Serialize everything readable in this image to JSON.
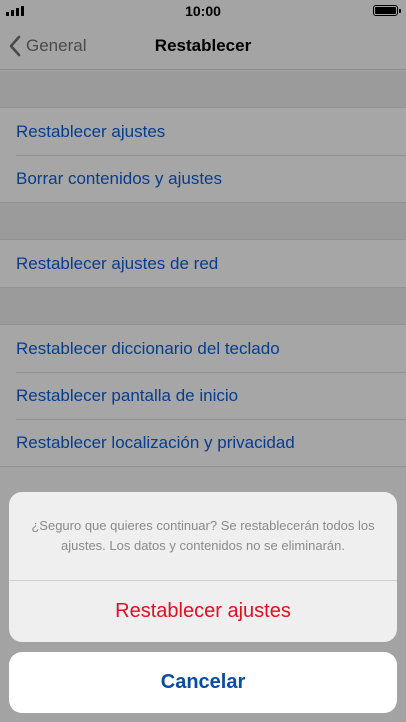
{
  "status": {
    "time": "10:00"
  },
  "nav": {
    "back_label": "General",
    "title": "Restablecer"
  },
  "groups": [
    {
      "items": [
        "Restablecer ajustes",
        "Borrar contenidos y ajustes"
      ]
    },
    {
      "items": [
        "Restablecer ajustes de red"
      ]
    },
    {
      "items": [
        "Restablecer diccionario del teclado",
        "Restablecer pantalla de inicio",
        "Restablecer localización y privacidad"
      ]
    }
  ],
  "sheet": {
    "message": "¿Seguro que quieres continuar? Se restablecerán todos los ajustes. Los datos y contenidos no se eliminarán.",
    "destructive_label": "Restablecer ajustes",
    "cancel_label": "Cancelar"
  },
  "icons": {
    "back": "chevron-left-icon",
    "signal": "cellular-signal-icon",
    "battery": "battery-full-icon"
  },
  "colors": {
    "link": "#083c8c",
    "destructive": "#e01020",
    "cancel": "#0a4ca0"
  }
}
